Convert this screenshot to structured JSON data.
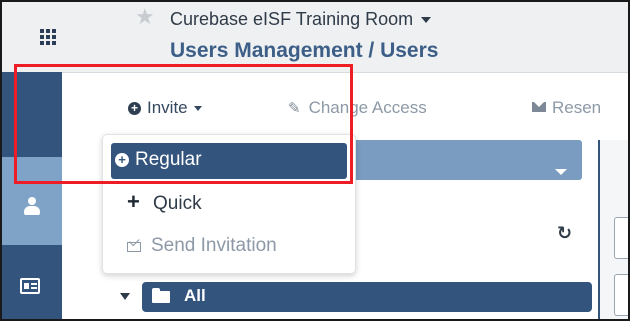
{
  "header": {
    "room_title": "Curebase eISF Training Room",
    "page_title": "Users Management / Users"
  },
  "toolbar": {
    "invite_label": "Invite",
    "change_access_label": "Change Access",
    "resend_label": "Resen"
  },
  "invite_menu": {
    "items": [
      {
        "label": "Regular",
        "icon": "plus-circle-icon",
        "highlighted": true
      },
      {
        "label": "Quick",
        "icon": "plus-icon"
      },
      {
        "label": "Send Invitation",
        "icon": "envelope-outline-icon"
      }
    ]
  },
  "tree": {
    "root_label": "All"
  },
  "colors": {
    "primary_dark": "#33547d",
    "primary_light": "#7fa3c6",
    "highlight_red": "#ee1c24"
  }
}
